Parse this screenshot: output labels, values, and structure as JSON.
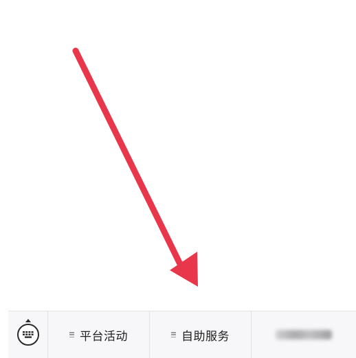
{
  "annotation": {
    "arrow_color": "#e8364a"
  },
  "menu_bar": {
    "keyboard_icon": "keyboard-icon",
    "items": [
      {
        "label": "平台活动",
        "icon": "menu-lines-icon"
      },
      {
        "label": "自助服务",
        "icon": "menu-lines-icon"
      }
    ],
    "blurred_item_icon": "blurred-text"
  },
  "colors": {
    "bar_background": "#f7f7f9",
    "divider": "#e2e2e6",
    "text": "#1f1f1f"
  }
}
